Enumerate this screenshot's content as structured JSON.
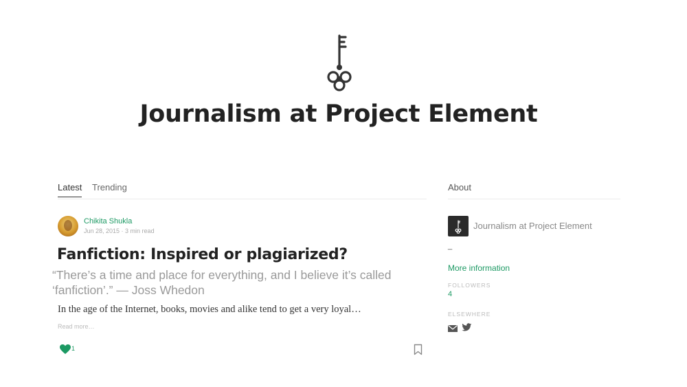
{
  "publication": {
    "title": "Journalism at Project Element",
    "logo_icon": "skeleton-key-icon"
  },
  "tabs": [
    {
      "label": "Latest",
      "active": true
    },
    {
      "label": "Trending",
      "active": false
    }
  ],
  "post": {
    "author": "Chikita Shukla",
    "date": "Jun 28, 2015",
    "read_time": "3 min read",
    "title": "Fanfiction: Inspired or plagiarized?",
    "subtitle": "“There’s a time and place for everything, and I believe it’s called ‘fanfiction’.” — Joss Whedon",
    "excerpt": "In the age of the Internet, books, movies and alike tend to get a very loyal…",
    "read_more": "Read more…",
    "likes": "1"
  },
  "about": {
    "heading": "About",
    "pub_name": "Journalism at Project Element",
    "description": "_",
    "more_info": "More information",
    "followers_label": "FOLLOWERS",
    "followers_count": "4",
    "elsewhere_label": "ELSEWHERE"
  },
  "colors": {
    "accent": "#1c9963",
    "text": "#222222",
    "muted": "#999999"
  }
}
